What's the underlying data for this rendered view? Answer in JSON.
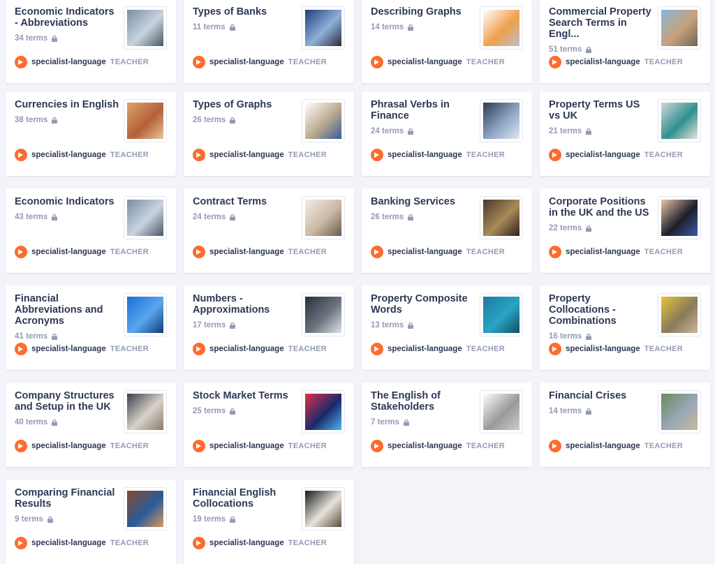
{
  "author": {
    "name": "specialist-language",
    "role": "TEACHER"
  },
  "sets": [
    {
      "title": "Economic Indicators - Abbreviations",
      "terms": "34 terms",
      "image": "city-street-aerial",
      "colors": [
        "#7a8ea6",
        "#c9d3de",
        "#4a5566"
      ]
    },
    {
      "title": "Types of Banks",
      "terms": "11 terms",
      "image": "bank-facade",
      "colors": [
        "#1f3f7a",
        "#8fb0d8",
        "#2a2a3a"
      ]
    },
    {
      "title": "Describing Graphs",
      "terms": "14 terms",
      "image": "graph-sketch",
      "colors": [
        "#ffffff",
        "#f0a04b",
        "#b8c0c8"
      ]
    },
    {
      "title": "Commercial Property Search Terms in Engl...",
      "terms": "51 terms",
      "image": "building-terrace",
      "colors": [
        "#8cb4d8",
        "#c7a27b",
        "#6c6457"
      ]
    },
    {
      "title": "Currencies in English",
      "terms": "38 terms",
      "image": "banknotes",
      "colors": [
        "#d8a56a",
        "#b65f3a",
        "#e7c49a"
      ]
    },
    {
      "title": "Types of Graphs",
      "terms": "26 terms",
      "image": "cycle-diagram",
      "colors": [
        "#ffffff",
        "#b9a98b",
        "#3a5a9a"
      ]
    },
    {
      "title": "Phrasal Verbs in Finance",
      "terms": "24 terms",
      "image": "business-people",
      "colors": [
        "#2f3b52",
        "#8ea6c4",
        "#e0e6ee"
      ]
    },
    {
      "title": "Property Terms US vs UK",
      "terms": "21 terms",
      "image": "interior-room",
      "colors": [
        "#cfd9d6",
        "#2f8f8f",
        "#e9e4da"
      ]
    },
    {
      "title": "Economic Indicators",
      "terms": "43 terms",
      "image": "city-street-aerial",
      "colors": [
        "#7a8ea6",
        "#c9d3de",
        "#4a5566"
      ]
    },
    {
      "title": "Contract Terms",
      "terms": "24 terms",
      "image": "signing-document",
      "colors": [
        "#f2ece4",
        "#c9b9a4",
        "#6b5a4b"
      ]
    },
    {
      "title": "Banking Services",
      "terms": "26 terms",
      "image": "safe-deposit-boxes",
      "colors": [
        "#4a3a2a",
        "#a98a5a",
        "#2a2018"
      ]
    },
    {
      "title": "Corporate Positions in the UK and the US",
      "terms": "22 terms",
      "image": "executive-portrait",
      "colors": [
        "#e8c4a8",
        "#1e1e2a",
        "#3b5ba6"
      ]
    },
    {
      "title": "Financial Abbreviations and Acronyms",
      "terms": "41 terms",
      "image": "atm-machine",
      "colors": [
        "#1c6fd0",
        "#5aa6f0",
        "#0e3c7a"
      ]
    },
    {
      "title": "Numbers - Approximations",
      "terms": "17 terms",
      "image": "number-keys",
      "colors": [
        "#2a2f38",
        "#6c7480",
        "#dfe3e8"
      ]
    },
    {
      "title": "Property Composite Words",
      "terms": "13 terms",
      "image": "blue-doors",
      "colors": [
        "#1d7a9e",
        "#2aa3c4",
        "#0f4f66"
      ]
    },
    {
      "title": "Property Collocations - Combinations",
      "terms": "16 terms",
      "image": "yellow-pipe",
      "colors": [
        "#e6c43a",
        "#8a7a5a",
        "#c9b89a"
      ]
    },
    {
      "title": "Company Structures and Setup in the UK",
      "terms": "40 terms",
      "image": "handshake-meeting",
      "colors": [
        "#3a3f4a",
        "#d8d2c8",
        "#8a7a6a"
      ]
    },
    {
      "title": "Stock Market Terms",
      "terms": "25 terms",
      "image": "phone-chart",
      "colors": [
        "#e0304a",
        "#1a2a6a",
        "#4fb4f0"
      ]
    },
    {
      "title": "The English of Stakeholders",
      "terms": "7 terms",
      "image": "text-worksheet",
      "colors": [
        "#ffffff",
        "#999999",
        "#cccccc"
      ]
    },
    {
      "title": "Financial Crises",
      "terms": "14 terms",
      "image": "aerial-town",
      "colors": [
        "#6a8a5a",
        "#9aa8b8",
        "#c8b89a"
      ]
    },
    {
      "title": "Comparing Financial Results",
      "terms": "9 terms",
      "image": "factory-workshop",
      "colors": [
        "#8a4a2a",
        "#2a5a9a",
        "#d89a5a"
      ]
    },
    {
      "title": "Financial English Collocations",
      "terms": "19 terms",
      "image": "notebook-coffee",
      "colors": [
        "#1a1a1a",
        "#e8e4dc",
        "#5a4a3a"
      ]
    }
  ]
}
